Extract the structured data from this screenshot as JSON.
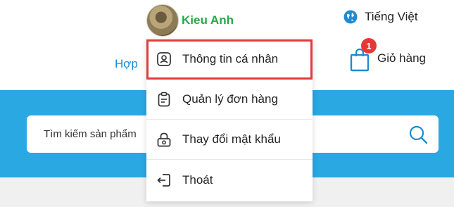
{
  "header": {
    "user_name": "Kieu Anh",
    "language_label": "Tiếng Việt",
    "partial_link": "Hợp",
    "cart_label": "Giỏ hàng",
    "cart_count": "1"
  },
  "search": {
    "placeholder": "Tìm kiếm sản phẩm"
  },
  "user_menu": {
    "items": [
      {
        "label": "Thông tin cá nhân",
        "icon": "profile-icon",
        "highlighted": true
      },
      {
        "label": "Quản lý đơn hàng",
        "icon": "clipboard-icon",
        "highlighted": false
      },
      {
        "label": "Thay đổi mật khẩu",
        "icon": "lock-icon",
        "highlighted": false
      },
      {
        "label": "Thoát",
        "icon": "logout-icon",
        "highlighted": false
      }
    ]
  },
  "colors": {
    "accent_blue": "#2aa8e2",
    "username_green": "#27a84a",
    "highlight_red": "#e23b3b",
    "badge_red": "#e53935",
    "link_blue": "#1f8bd2"
  }
}
